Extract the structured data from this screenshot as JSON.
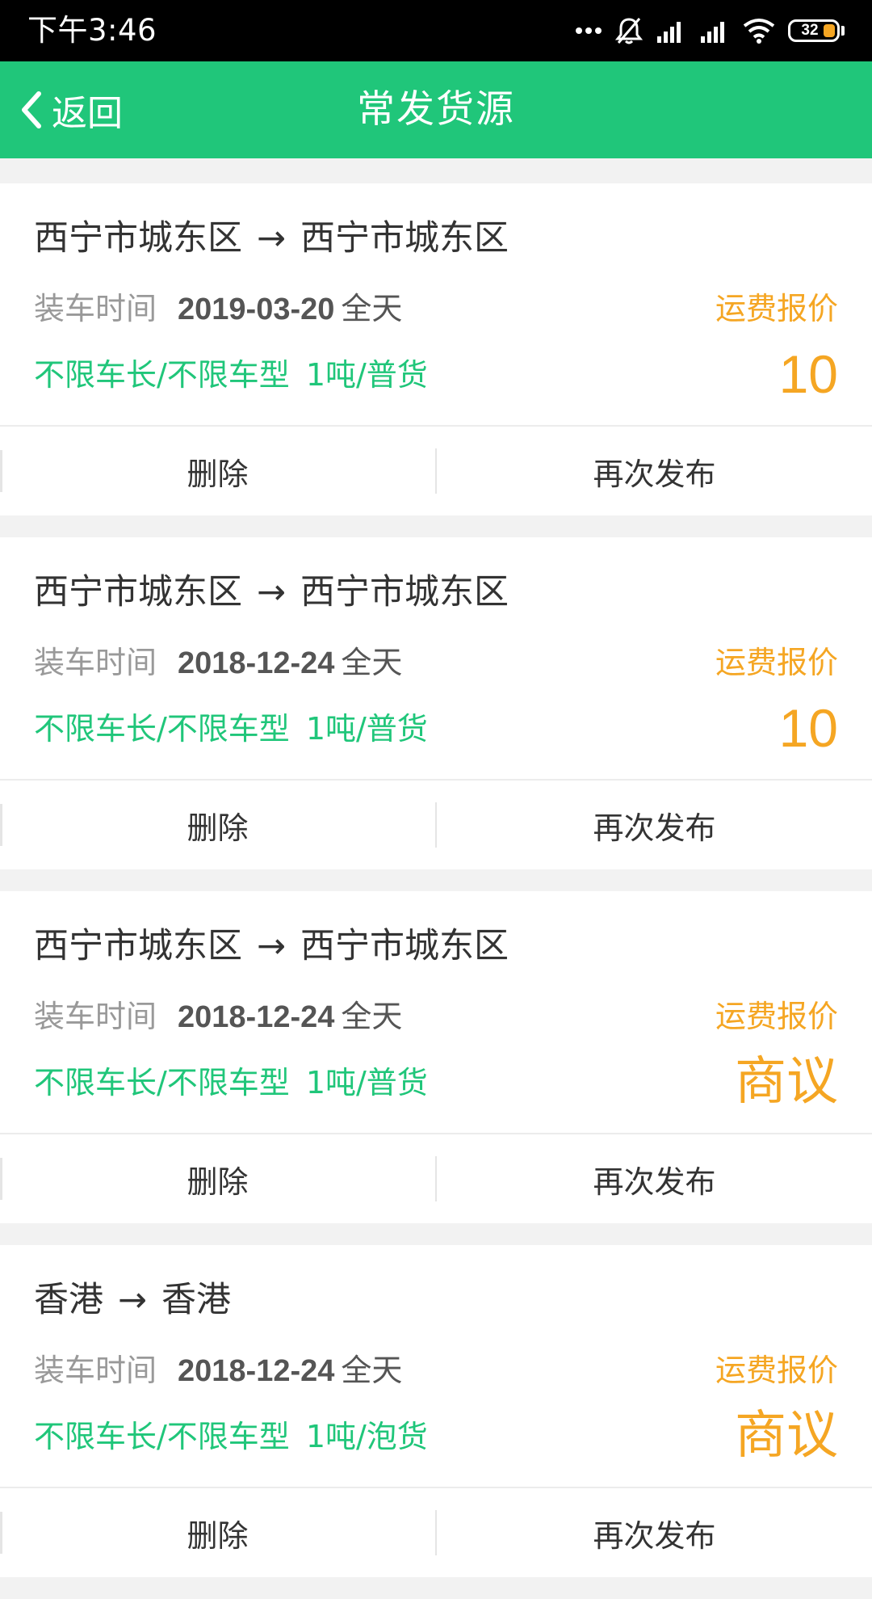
{
  "status_bar": {
    "time": "下午3:46",
    "battery": "32"
  },
  "app_bar": {
    "back_label": "返回",
    "title": "常发货源"
  },
  "labels": {
    "load_time": "装车时间",
    "price": "运费报价",
    "delete": "删除",
    "republish": "再次发布"
  },
  "cards": [
    {
      "from": "西宁市城东区",
      "to": "西宁市城东区",
      "date": "2019-03-20",
      "period": "全天",
      "vehicle": "不限车长/不限车型",
      "cargo": "1吨/普货",
      "price": "10"
    },
    {
      "from": "西宁市城东区",
      "to": "西宁市城东区",
      "date": "2018-12-24",
      "period": "全天",
      "vehicle": "不限车长/不限车型",
      "cargo": "1吨/普货",
      "price": "10"
    },
    {
      "from": "西宁市城东区",
      "to": "西宁市城东区",
      "date": "2018-12-24",
      "period": "全天",
      "vehicle": "不限车长/不限车型",
      "cargo": "1吨/普货",
      "price": "商议"
    },
    {
      "from": "香港",
      "to": "香港",
      "date": "2018-12-24",
      "period": "全天",
      "vehicle": "不限车长/不限车型",
      "cargo": "1吨/泡货",
      "price": "商议"
    }
  ],
  "colors": {
    "primary": "#20c67a",
    "price": "#f5a623",
    "background": "#f2f2f2"
  }
}
